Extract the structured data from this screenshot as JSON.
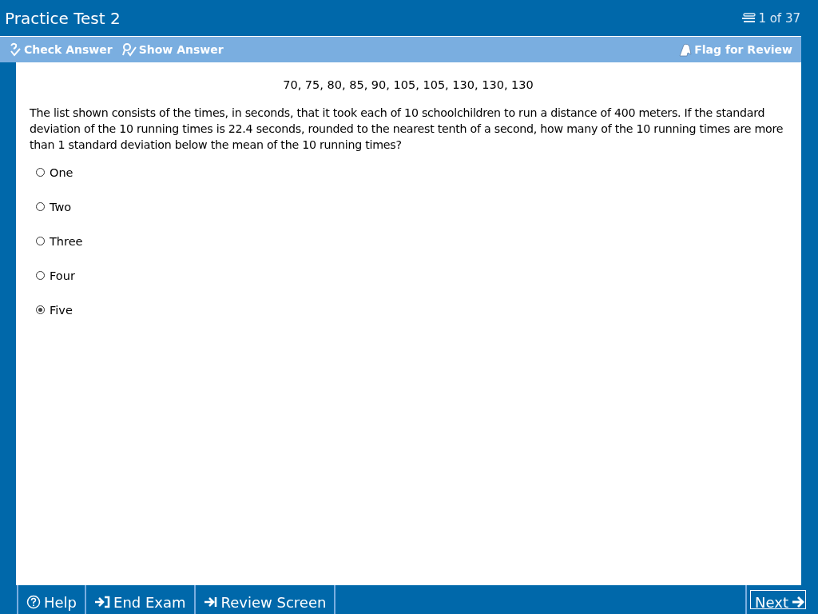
{
  "window": {
    "title": "Practice Test 2",
    "progress": "1 of 37"
  },
  "toolbar": {
    "left": [
      {
        "label": "Check Answer",
        "kind": "check"
      },
      {
        "label": "Show Answer",
        "kind": "show"
      }
    ],
    "right": {
      "label": "Flag for Review",
      "kind": "flag"
    }
  },
  "question": {
    "data_list": "70, 75, 80, 85, 90, 105, 105, 130, 130, 130",
    "text": "The list shown consists of the times, in seconds, that it took each of 10 schoolchildren to run a distance of 400 meters.  If the standard deviation of the 10 running times is 22.4 seconds, rounded to the nearest tenth of a second, how many of the 10 running times are more than 1 standard deviation below the mean of the 10 running times?",
    "options": [
      {
        "label": "One",
        "selected": false
      },
      {
        "label": "Two",
        "selected": false
      },
      {
        "label": "Three",
        "selected": false
      },
      {
        "label": "Four",
        "selected": false
      },
      {
        "label": "Five",
        "selected": true
      }
    ]
  },
  "footer": {
    "buttons": [
      {
        "label": "Help",
        "kind": "help"
      },
      {
        "label": "End Exam",
        "kind": "end"
      },
      {
        "label": "Review Screen",
        "kind": "review"
      }
    ],
    "next": "Next"
  }
}
